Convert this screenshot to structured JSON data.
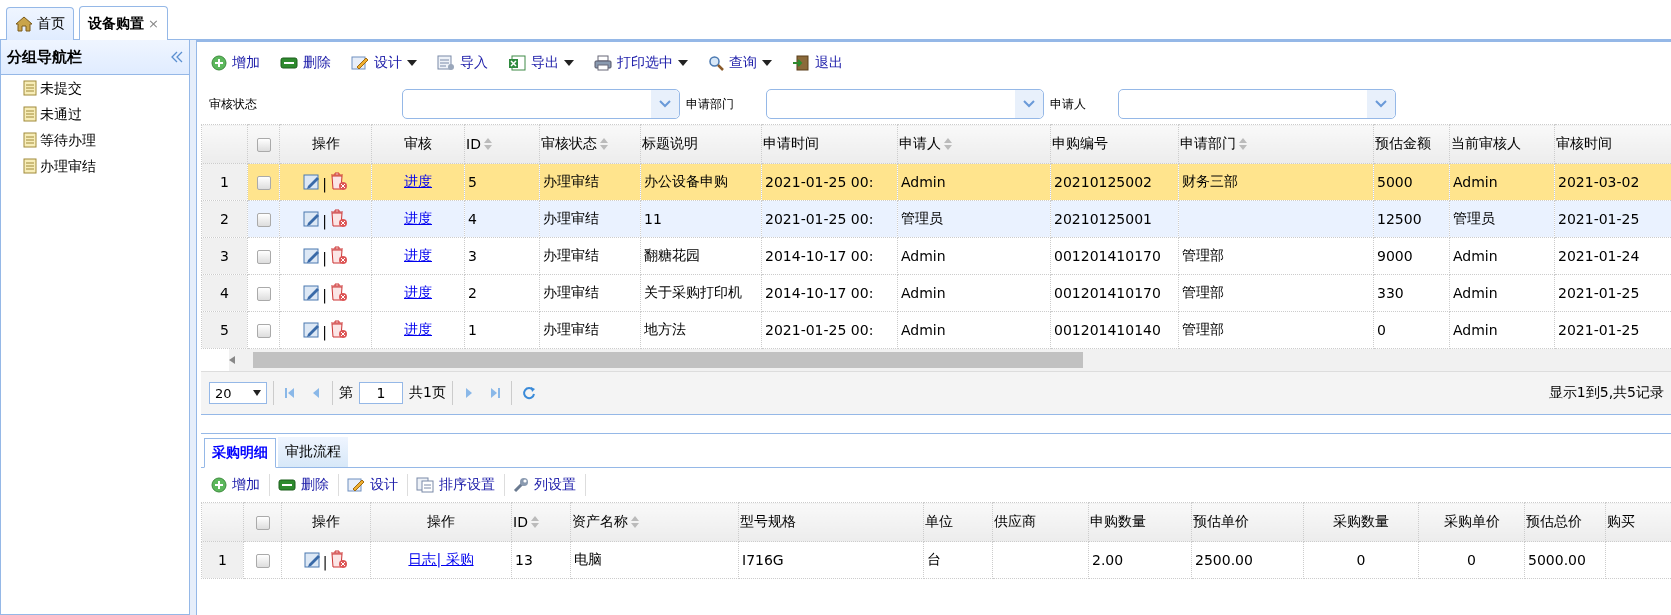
{
  "tabs": [
    {
      "label": "首页",
      "closable": false,
      "selected": false
    },
    {
      "label": "设备购置",
      "closable": true,
      "close": "×",
      "selected": true
    }
  ],
  "sidebar": {
    "title": "分组导航栏",
    "items": [
      {
        "label": "未提交"
      },
      {
        "label": "未通过"
      },
      {
        "label": "等待办理"
      },
      {
        "label": "办理审结"
      }
    ]
  },
  "toolbar": [
    {
      "label": "增加",
      "dropdown": false
    },
    {
      "label": "删除",
      "dropdown": false
    },
    {
      "label": "设计",
      "dropdown": true
    },
    {
      "label": "导入",
      "dropdown": false
    },
    {
      "label": "导出",
      "dropdown": true
    },
    {
      "label": "打印选中",
      "dropdown": true
    },
    {
      "label": "查询",
      "dropdown": true
    },
    {
      "label": "退出",
      "dropdown": false
    }
  ],
  "filters": [
    {
      "label": "审核状态"
    },
    {
      "label": "申请部门"
    },
    {
      "label": "申请人"
    }
  ],
  "grid": {
    "all_checked": false,
    "columns": [
      {
        "label": "操作",
        "kind": "actions",
        "sortable": false
      },
      {
        "label": "审核",
        "kind": "link",
        "sortable": false
      },
      {
        "label": "ID",
        "kind": "text",
        "sortable": true
      },
      {
        "label": "审核状态",
        "kind": "text",
        "sortable": true
      },
      {
        "label": "标题说明",
        "kind": "text",
        "sortable": false
      },
      {
        "label": "申请时间",
        "kind": "text",
        "sortable": false
      },
      {
        "label": "申请人",
        "kind": "text",
        "sortable": true
      },
      {
        "label": "申购编号",
        "kind": "text",
        "sortable": false
      },
      {
        "label": "申请部门",
        "kind": "text",
        "sortable": true
      },
      {
        "label": "预估金额",
        "kind": "text",
        "sortable": false
      },
      {
        "label": "当前审核人",
        "kind": "text",
        "sortable": false
      },
      {
        "label": "审核时间",
        "kind": "text",
        "sortable": false
      }
    ],
    "rows": [
      {
        "num": "1",
        "checked": false,
        "selected": true,
        "hover": false,
        "cells": [
          "|",
          "进度",
          "5",
          "办理审结",
          "办公设备申购",
          "2021-01-25 00:",
          "Admin",
          "20210125002",
          "财务三部",
          "5000",
          "Admin",
          "2021-03-02"
        ]
      },
      {
        "num": "2",
        "checked": false,
        "selected": false,
        "hover": true,
        "cells": [
          "|",
          "进度",
          "4",
          "办理审结",
          "11",
          "2021-01-25 00:",
          "管理员",
          "20210125001",
          "",
          "12500",
          "管理员",
          "2021-01-25"
        ]
      },
      {
        "num": "3",
        "checked": false,
        "selected": false,
        "hover": false,
        "cells": [
          "|",
          "进度",
          "3",
          "办理审结",
          "翻糖花园",
          "2014-10-17 00:",
          "Admin",
          "001201410170",
          "管理部",
          "9000",
          "Admin",
          "2021-01-24"
        ]
      },
      {
        "num": "4",
        "checked": false,
        "selected": false,
        "hover": false,
        "cells": [
          "|",
          "进度",
          "2",
          "办理审结",
          "关于采购打印机",
          "2014-10-17 00:",
          "Admin",
          "001201410170",
          "管理部",
          "330",
          "Admin",
          "2021-01-25"
        ]
      },
      {
        "num": "5",
        "checked": false,
        "selected": false,
        "hover": false,
        "cells": [
          "|",
          "进度",
          "1",
          "办理审结",
          "地方法",
          "2021-01-25 00:",
          "Admin",
          "001201410140",
          "管理部",
          "0",
          "Admin",
          "2021-01-25"
        ]
      }
    ]
  },
  "pager": {
    "page_size": "20",
    "page_prefix": "第",
    "page": "1",
    "page_total": "共1页",
    "summary": "显示1到5,共5记录"
  },
  "detail_tabs": [
    {
      "label": "采购明细",
      "selected": true
    },
    {
      "label": "审批流程",
      "selected": false
    }
  ],
  "detail_toolbar": [
    {
      "label": "增加"
    },
    {
      "label": "删除"
    },
    {
      "label": "设计"
    },
    {
      "label": "排序设置"
    },
    {
      "label": "列设置"
    }
  ],
  "detail_grid": {
    "all_checked": false,
    "columns": [
      {
        "label": "操作",
        "kind": "actions",
        "sortable": false
      },
      {
        "label": "操作",
        "kind": "link",
        "sortable": false
      },
      {
        "label": "ID",
        "kind": "text",
        "sortable": true
      },
      {
        "label": "资产名称",
        "kind": "text",
        "sortable": true
      },
      {
        "label": "型号规格",
        "kind": "text",
        "sortable": false
      },
      {
        "label": "单位",
        "kind": "text",
        "sortable": false
      },
      {
        "label": "供应商",
        "kind": "text",
        "sortable": false
      },
      {
        "label": "申购数量",
        "kind": "text",
        "sortable": false
      },
      {
        "label": "预估单价",
        "kind": "text",
        "sortable": false
      },
      {
        "label": "采购数量",
        "kind": "text",
        "sortable": false
      },
      {
        "label": "采购单价",
        "kind": "text",
        "sortable": false
      },
      {
        "label": "预估总价",
        "kind": "text",
        "sortable": false
      },
      {
        "label": "购买",
        "kind": "text",
        "sortable": false
      }
    ],
    "rows": [
      {
        "num": "1",
        "checked": false,
        "selected": false,
        "hover": false,
        "cells": [
          "|",
          "日志| 采购",
          "13",
          "电脑",
          "I716G",
          "台",
          "",
          "2.00",
          "2500.00",
          "0",
          "0",
          "5000.00",
          ""
        ]
      }
    ]
  }
}
